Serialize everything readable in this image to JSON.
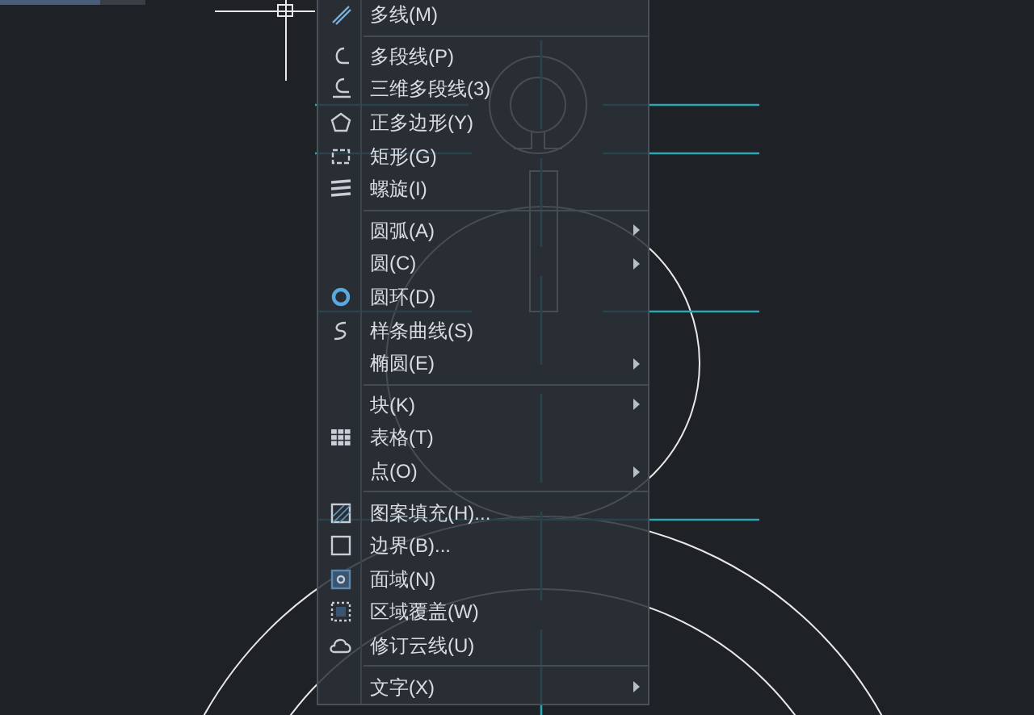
{
  "menu": {
    "items": [
      {
        "kind": "item",
        "label": "多线(M)",
        "submenu": false
      },
      {
        "kind": "separator"
      },
      {
        "kind": "item",
        "label": "多段线(P)",
        "submenu": false
      },
      {
        "kind": "item",
        "label": "三维多段线(3)",
        "submenu": false
      },
      {
        "kind": "item",
        "label": "正多边形(Y)",
        "submenu": false
      },
      {
        "kind": "item",
        "label": "矩形(G)",
        "submenu": false
      },
      {
        "kind": "item",
        "label": "螺旋(I)",
        "submenu": false
      },
      {
        "kind": "separator"
      },
      {
        "kind": "item",
        "label": "圆弧(A)",
        "submenu": true
      },
      {
        "kind": "item",
        "label": "圆(C)",
        "submenu": true
      },
      {
        "kind": "item",
        "label": "圆环(D)",
        "submenu": false
      },
      {
        "kind": "item",
        "label": "样条曲线(S)",
        "submenu": false
      },
      {
        "kind": "item",
        "label": "椭圆(E)",
        "submenu": true
      },
      {
        "kind": "separator"
      },
      {
        "kind": "item",
        "label": "块(K)",
        "submenu": true
      },
      {
        "kind": "item",
        "label": "表格(T)",
        "submenu": false
      },
      {
        "kind": "item",
        "label": "点(O)",
        "submenu": true
      },
      {
        "kind": "separator"
      },
      {
        "kind": "item",
        "label": "图案填充(H)...",
        "submenu": false
      },
      {
        "kind": "item",
        "label": "边界(B)...",
        "submenu": false
      },
      {
        "kind": "item",
        "label": "面域(N)",
        "submenu": false
      },
      {
        "kind": "item",
        "label": "区域覆盖(W)",
        "submenu": false
      },
      {
        "kind": "item",
        "label": "修订云线(U)",
        "submenu": false
      },
      {
        "kind": "separator"
      },
      {
        "kind": "item",
        "label": "文字(X)",
        "submenu": true
      }
    ]
  }
}
